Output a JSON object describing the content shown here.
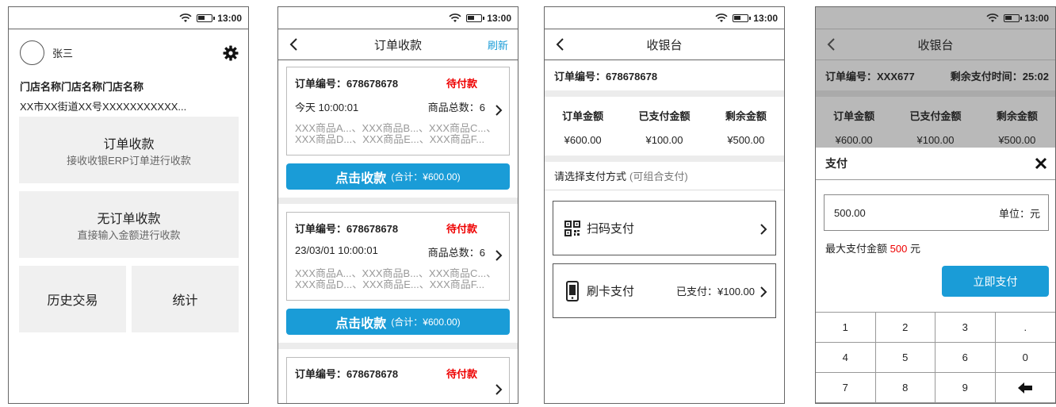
{
  "status": {
    "time": "13:00"
  },
  "screen1": {
    "user_name": "张三",
    "store_name": "门店名称门店名称门店名称",
    "store_address": "XX市XX街道XX号XXXXXXXXXXX...",
    "tiles": {
      "order_pay": {
        "title": "订单收款",
        "subtitle": "接收收银ERP订单进行收款"
      },
      "no_order_pay": {
        "title": "无订单收款",
        "subtitle": "直接输入金额进行收款"
      },
      "history": {
        "title": "历史交易"
      },
      "stats": {
        "title": "统计"
      }
    }
  },
  "screen2": {
    "title": "订单收款",
    "refresh": "刷新",
    "orders": [
      {
        "number": "订单编号：678678678",
        "status": "待付款",
        "time": "今天 10:00:01",
        "count": "商品总数：6",
        "items1": "XXX商品A...、XXX商品B...、XXX商品C...、",
        "items2": "XXX商品D...、XXX商品E...、XXX商品F...",
        "button": "点击收款",
        "total": "(合计：¥600.00)"
      },
      {
        "number": "订单编号：678678678",
        "status": "待付款",
        "time": "23/03/01  10:00:01",
        "count": "商品总数：6",
        "items1": "XXX商品A...、XXX商品B...、XXX商品C...、",
        "items2": "XXX商品D...、XXX商品E...、XXX商品F...",
        "button": "点击收款",
        "total": "(合计：¥600.00)"
      },
      {
        "number": "订单编号：678678678",
        "status": "待付款"
      }
    ]
  },
  "screen3": {
    "title": "收银台",
    "order_number": "订单编号：678678678",
    "amounts": [
      {
        "label": "订单金额",
        "value": "¥600.00"
      },
      {
        "label": "已支付金额",
        "value": "¥100.00"
      },
      {
        "label": "剩余金额",
        "value": "¥500.00"
      }
    ],
    "choose_label": "请选择支付方式",
    "choose_hint": "(可组合支付)",
    "methods": {
      "scan": {
        "label": "扫码支付"
      },
      "card": {
        "label": "刷卡支付",
        "paid": "已支付：¥100.00"
      }
    }
  },
  "screen4": {
    "title": "收银台",
    "order_number": "订单编号：XXX677",
    "remaining_time": "剩余支付时间：25:02",
    "amounts": [
      {
        "label": "订单金额",
        "value": "¥600.00"
      },
      {
        "label": "已支付金额",
        "value": "¥100.00"
      },
      {
        "label": "剩余金额",
        "value": "¥500.00"
      }
    ],
    "sheet": {
      "title": "支付",
      "amount_value": "500.00",
      "unit": "单位：元",
      "max_prefix": "最大支付金额 ",
      "max_value": "500",
      "max_suffix": " 元",
      "pay_now": "立即支付"
    },
    "keys": [
      "1",
      "2",
      "3",
      ".",
      "4",
      "5",
      "6",
      "0",
      "7",
      "8",
      "9"
    ]
  },
  "colors": {
    "accent": "#1a9cd7",
    "status_red": "#e00000"
  }
}
